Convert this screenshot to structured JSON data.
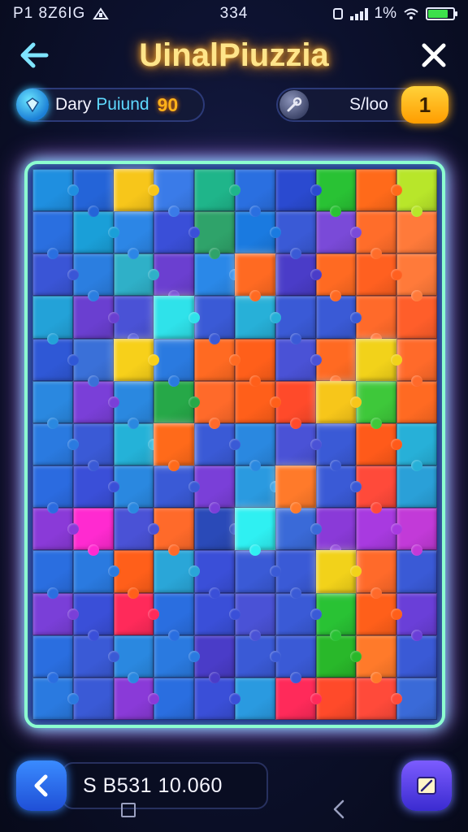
{
  "status_bar": {
    "left_text": "P1 8Z6IG",
    "time": "334",
    "battery_text": "1%",
    "battery_level": 0.8
  },
  "header": {
    "title": "UinalPiuzzia",
    "back_icon": "arrow-left-icon",
    "close_icon": "close-icon"
  },
  "daily": {
    "label_part1": "Dary",
    "label_part2": "Puiund",
    "score": "90",
    "icon": "gem-icon"
  },
  "hint": {
    "label": "S/loo",
    "count": "1",
    "icon": "wrench-icon"
  },
  "board": {
    "cols": 10,
    "rows": 13,
    "colors": [
      [
        "#1f8fe0",
        "#2464d8",
        "#f7c61a",
        "#3a7be8",
        "#1fb58a",
        "#2a6fe0",
        "#2a4ad0",
        "#29c234",
        "#ff6a1a",
        "#b8e62a"
      ],
      [
        "#2a6fe0",
        "#1a9fd8",
        "#2c86e6",
        "#3a4fd8",
        "#2fa36a",
        "#1a7ae0",
        "#3a5ad6",
        "#7a4ad8",
        "#ff6d2a",
        "#ff7a3a"
      ],
      [
        "#3a55d6",
        "#2b7ee0",
        "#2fb0c8",
        "#6b3fd0",
        "#2a88e8",
        "#ff6a22",
        "#4a3cc8",
        "#ff6a22",
        "#ff6020",
        "#ff7a3a"
      ],
      [
        "#23a2d8",
        "#6a3fd0",
        "#4a52d6",
        "#2fe2ea",
        "#3a5ad6",
        "#27b0d8",
        "#3a5ad6",
        "#3a5ad6",
        "#ff6a2a",
        "#ff5e2a"
      ],
      [
        "#2f58d6",
        "#3a70d8",
        "#f7d01a",
        "#2a7ae0",
        "#ff6a22",
        "#ff5f1a",
        "#4a52d6",
        "#ff6a22",
        "#f2d21a",
        "#ff6a2a"
      ],
      [
        "#2a88e0",
        "#7a3fd8",
        "#2a88e0",
        "#26a848",
        "#ff6a2a",
        "#ff5f1a",
        "#ff4a2a",
        "#f7c61a",
        "#3ec83a",
        "#ff6a22"
      ],
      [
        "#2a7ae0",
        "#3a5ad6",
        "#24b2d8",
        "#ff6a1a",
        "#3a5ad6",
        "#2a88e0",
        "#4a52d6",
        "#3a5ad6",
        "#ff5a1a",
        "#27b0d8"
      ],
      [
        "#2b6be0",
        "#3a4fd8",
        "#2a88e0",
        "#3a5ad6",
        "#7a3fd8",
        "#2a9ae0",
        "#ff7a2a",
        "#3a5ad6",
        "#ff4a3a",
        "#2aa0d8"
      ],
      [
        "#8a3ad8",
        "#ff2ad0",
        "#4a52d6",
        "#ff6a2a",
        "#2a4ab8",
        "#2ff0f2",
        "#3a6ad8",
        "#8a3ad8",
        "#a83ae0",
        "#c23ad8"
      ],
      [
        "#2a6ee0",
        "#2a7ae0",
        "#ff5f1a",
        "#2aa6d8",
        "#3a4fd8",
        "#3a5ad6",
        "#3a5ad6",
        "#f2d21a",
        "#ff6a2a",
        "#3a5ad6"
      ],
      [
        "#7a3fd8",
        "#3a4fd8",
        "#ff2a5a",
        "#2a6ee0",
        "#3a4fd8",
        "#4a52d6",
        "#3a5ad6",
        "#29c234",
        "#ff5f1a",
        "#6a3fd8"
      ],
      [
        "#2a6ee0",
        "#3a5ad6",
        "#2a88e0",
        "#2a7ae0",
        "#4a3cc8",
        "#3a5ad6",
        "#3a5ad6",
        "#29b82a",
        "#ff7a2a",
        "#3a5ad6"
      ],
      [
        "#2a7ae0",
        "#3a5ad6",
        "#8a3ad8",
        "#2a6ee0",
        "#3a4fd8",
        "#2a9ae0",
        "#ff2a5a",
        "#ff4a2a",
        "#ff4a3a",
        "#3a6ad8"
      ]
    ],
    "highlight": [
      [
        0,
        2
      ],
      [
        2,
        5
      ],
      [
        3,
        3
      ],
      [
        4,
        2
      ],
      [
        4,
        8
      ],
      [
        5,
        7
      ],
      [
        6,
        3
      ],
      [
        7,
        6
      ],
      [
        8,
        5
      ],
      [
        9,
        7
      ]
    ]
  },
  "bottom": {
    "coins_text": "S B531 10.060",
    "back_icon": "chevron-left-icon",
    "edit_icon": "note-edit-icon"
  }
}
